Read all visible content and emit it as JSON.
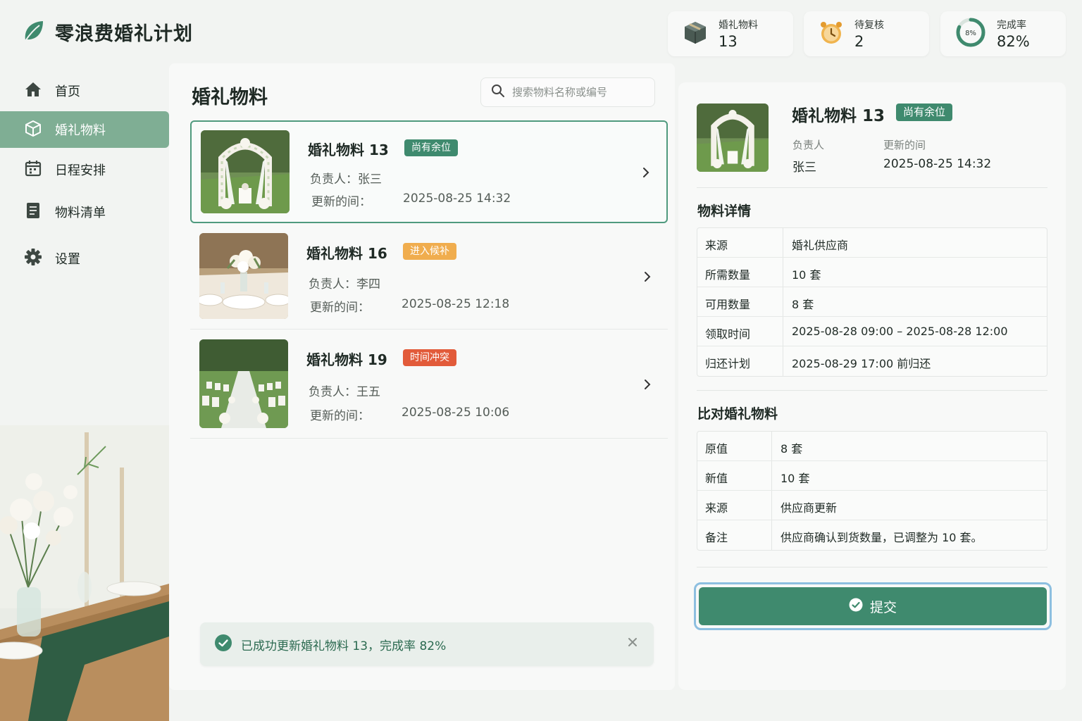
{
  "app": {
    "title": "零浪费婚礼计划"
  },
  "stats": [
    {
      "label": "婚礼物料",
      "value": "13",
      "icon": "box-icon"
    },
    {
      "label": "待复核",
      "value": "2",
      "icon": "alarm-clock-icon"
    },
    {
      "label": "完成率",
      "value": "82%",
      "ring_text": "8%",
      "progress_fraction": 0.82,
      "icon": "progress-ring-icon"
    }
  ],
  "sidebar": {
    "items": [
      {
        "label": "首页",
        "icon": "home-icon"
      },
      {
        "label": "婚礼物料",
        "icon": "cube-icon",
        "active": true
      },
      {
        "label": "日程安排",
        "icon": "calendar-icon"
      },
      {
        "label": "物料清单",
        "icon": "checklist-icon"
      },
      {
        "label": "设置",
        "icon": "gear-icon"
      }
    ]
  },
  "main": {
    "title": "婚礼物料",
    "search_placeholder": "搜索物料名称或编号",
    "items": [
      {
        "name": "婚礼物料 13",
        "badge": "尚有余位",
        "badge_color": "#3f8a6e",
        "owner": "负责人：张三",
        "updated_label": "更新的间：",
        "updated": "2025-08-25 14:32",
        "image": "wedding-arch-photo"
      },
      {
        "name": "婚礼物料 16",
        "badge": "进入候补",
        "badge_color": "#f0ad4e",
        "owner": "负责人：李四",
        "updated_label": "更新的间：",
        "updated": "2025-08-25 12:18",
        "image": "table-setting-photo"
      },
      {
        "name": "婚礼物料 19",
        "badge": "时间冲突",
        "badge_color": "#e25b3a",
        "owner": "负责人：王五",
        "updated_label": "更新的间：",
        "updated": "2025-08-25 10:06",
        "image": "aisle-chairs-photo"
      }
    ],
    "toast": "已成功更新婚礼物料 13，完成率 82%"
  },
  "detail": {
    "title": "婚礼物料 13",
    "badge": "尚有余位",
    "owner_label": "负责人",
    "owner": "张三",
    "updated_label": "更新的间",
    "updated": "2025-08-25 14:32",
    "details_title": "物料详情",
    "details": [
      {
        "key": "来源",
        "value": "婚礼供应商"
      },
      {
        "key": "所需数量",
        "value": "10 套"
      },
      {
        "key": "可用数量",
        "value": "8 套"
      },
      {
        "key": "领取时间",
        "value": "2025-08-28 09:00 – 2025-08-28 12:00"
      },
      {
        "key": "归还计划",
        "value": "2025-08-29 17:00 前归还"
      }
    ],
    "compare_title": "比对婚礼物料",
    "compare": [
      {
        "key": "原值",
        "value": "8 套"
      },
      {
        "key": "新值",
        "value": "10 套"
      },
      {
        "key": "来源",
        "value": "供应商更新"
      },
      {
        "key": "备注",
        "value": "供应商确认到货数量，已调整为 10 套。"
      }
    ],
    "submit_label": "提交"
  },
  "colors": {
    "accent": "#3f8a6e",
    "sidebar_active": "#7fae94",
    "focus_ring": "#8dbfe0"
  }
}
